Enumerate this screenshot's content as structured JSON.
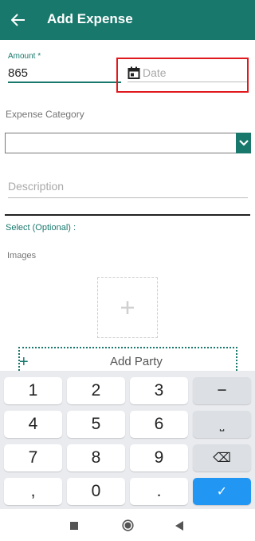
{
  "header": {
    "title": "Add Expense",
    "back_icon": "arrow-left-icon",
    "color": "#18786c"
  },
  "form": {
    "amount_label": "Amount *",
    "amount_value": "865",
    "date_placeholder": "Date",
    "date_icon": "calendar-icon",
    "category_label": "Expense Category",
    "category_value": "",
    "description_placeholder": "Description",
    "select_optional_label": "Select (Optional) :",
    "images_label": "Images",
    "add_image_icon": "plus-icon",
    "add_party_icon": "plus-icon",
    "add_party_label": "Add Party"
  },
  "highlight_color": "#e0191e",
  "keyboard": {
    "keys": [
      "1",
      "2",
      "3",
      "−",
      "4",
      "5",
      "6",
      "⎵",
      "7",
      "8",
      "9",
      "⌫",
      ",",
      "0",
      ".",
      "✓"
    ],
    "done_color": "#2196f3"
  },
  "navbar": {
    "icons": [
      "square-icon",
      "circle-icon",
      "triangle-back-icon"
    ]
  }
}
